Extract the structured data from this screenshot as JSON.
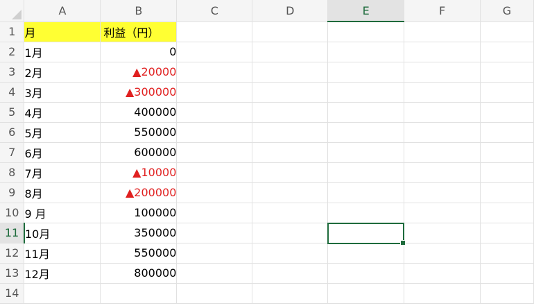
{
  "columns": [
    "A",
    "B",
    "C",
    "D",
    "E",
    "F",
    "G"
  ],
  "selected_column": "E",
  "selected_row": 11,
  "rows": [
    {
      "num": "1",
      "a": "月",
      "b": "利益（円）",
      "header": true
    },
    {
      "num": "2",
      "a": "1月",
      "b": "0"
    },
    {
      "num": "3",
      "a": "2月",
      "b": "▲20000",
      "negative": true
    },
    {
      "num": "4",
      "a": "3月",
      "b": "▲300000",
      "negative": true
    },
    {
      "num": "5",
      "a": "4月",
      "b": "400000"
    },
    {
      "num": "6",
      "a": "5月",
      "b": "550000"
    },
    {
      "num": "7",
      "a": "6月",
      "b": "600000"
    },
    {
      "num": "8",
      "a": "7月",
      "b": "▲10000",
      "negative": true
    },
    {
      "num": "9",
      "a": "8月",
      "b": "▲200000",
      "negative": true
    },
    {
      "num": "10",
      "a": "9 月",
      "b": "100000"
    },
    {
      "num": "11",
      "a": "10月",
      "b": "350000"
    },
    {
      "num": "12",
      "a": "11月",
      "b": "550000"
    },
    {
      "num": "13",
      "a": "12月",
      "b": "800000"
    },
    {
      "num": "14",
      "a": "",
      "b": ""
    }
  ],
  "colors": {
    "header_fill": "#ffff33",
    "negative_text": "#e02020",
    "selection": "#1e6b3c"
  },
  "icons": {
    "corner": "select-all-icon"
  }
}
